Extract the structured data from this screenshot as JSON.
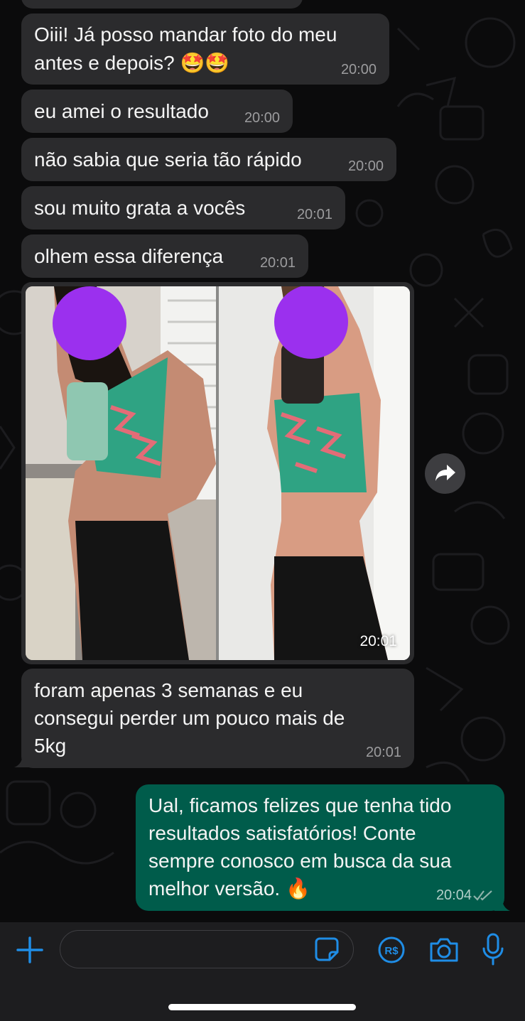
{
  "colors": {
    "incoming_bubble": "#2b2b2d",
    "outgoing_bubble": "#005c4b",
    "accent": "#1f8de6",
    "privacy_circle": "#9b30ee"
  },
  "messages": [
    {
      "text": "Oiii! Já posso mandar foto do meu",
      "text2": "antes e depois? 🤩🤩",
      "time": "20:00"
    },
    {
      "text": "eu amei o resultado",
      "time": "20:00"
    },
    {
      "text": "não sabia que seria tão rápido",
      "time": "20:00"
    },
    {
      "text": "sou muito grata a vocês",
      "time": "20:01"
    },
    {
      "text": "olhem essa diferença",
      "time": "20:01"
    }
  ],
  "photo_message": {
    "time": "20:01",
    "forward_icon": "forward-arrow-icon"
  },
  "long_message": {
    "line1": "foram apenas 3 semanas e eu",
    "line2": "consegui perder um pouco mais de",
    "line3": "5kg",
    "time": "20:01"
  },
  "reply_message": {
    "line1": "Ual, ficamos felizes que tenha tido",
    "line2": "resultados satisfatórios! Conte",
    "line3": "sempre conosco em busca da sua",
    "line4": "melhor versão. 🔥",
    "time": "20:04",
    "status_icon": "double-check-icon"
  },
  "input_bar": {
    "text_value": "",
    "icons": [
      "plus-icon",
      "sticker-icon",
      "payment-icon",
      "camera-icon",
      "microphone-icon"
    ]
  }
}
